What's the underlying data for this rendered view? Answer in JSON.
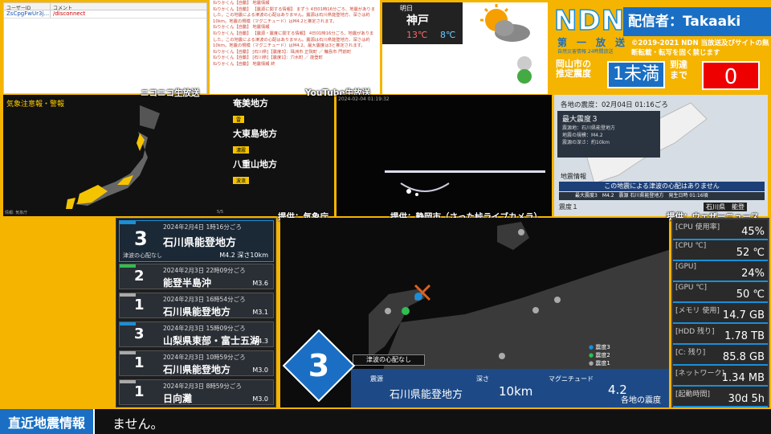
{
  "user_table": {
    "col_user": "ユーザーID",
    "col_comment": "コメント",
    "rows": [
      {
        "user": "ZsCpgFwUr3j...",
        "comment": "/disconnect"
      }
    ]
  },
  "log": [
    "ねりかくん【自動】 地震情報",
    "ねりかくん【自動】 【震源に関する情報】 まずう 4日01時16分ごろ、地震がありました。この地震による津波の心配はありません。震源は石川県能登地方、深さは約10km。地震の規模（マグニチュード）はM4.2と推定されます。",
    "ねりかくん【自動】 地震情報",
    "ねりかくん【自動】 【震源・震度に関する情報】 4日01時16分ごろ、地震がありました。この地震による津波の心配はありません。震源は石川県能登地方、深さは約10km。地震の規模（マグニチュード）はM4.2、最大震度は3と推定されます。",
    "ねりかくん【自動】 [石川県]【震度3】：珠洲市 正院町 ／ 輪島市 門前町",
    "ねりかくん【自動】 [石川県]【震度1】：穴水町 ／ 能登町",
    "ねりかくん【自動】 地震情報 終"
  ],
  "weather": {
    "day": "明日",
    "city": "神戸",
    "high": "13℃",
    "low": "8℃"
  },
  "ndn": {
    "logo": "NDN",
    "caster": "配信者：Takaaki",
    "first": "第　一　放　送",
    "first_sub": "自然災害情報 24時間放送",
    "copyright": "©2019-2021 NDN 当放送及びサイトの無断転載・転写を固く禁じます",
    "okayama": "岡山市の\n推定震度",
    "shindo": "1未満",
    "arrive": "到達\nまで",
    "seconds": "0"
  },
  "caps": {
    "nico": "ニコニコ生放送",
    "yt": "YouTube生放送",
    "jma": "提供：気象庁",
    "shizuoka": "提供：静岡市（さった峠ライブカメラ）",
    "wn": "提供：ウェザーニュース"
  },
  "japan": {
    "title": "気象注意報・警報",
    "areas": [
      {
        "name": "奄美地方",
        "badge": "雷"
      },
      {
        "name": "大東島地方",
        "badge": "濃霧"
      },
      {
        "name": "八重山地方",
        "badge": "波浪"
      }
    ],
    "page": "5/5",
    "footer": "情報: 気象庁"
  },
  "live": {
    "timestamp": "2024-02-04 01:19:32"
  },
  "info": {
    "header": "各地の震度：02月04日 01:16ごろ",
    "max": "最大震度３",
    "epi_label": "震源地：石川県能登地方",
    "mag_label": "地震の規模：M4.2",
    "depth_label": "震源の深さ：約10km",
    "tsunami": "この地震による津波の心配はありません",
    "badge": "地震情報",
    "bottom": "最大震度3　M4.2　震源 石川県能登地方　発生日時 01:16頃",
    "region": "石川県　能登",
    "level": "震度１"
  },
  "eq_list": [
    {
      "n": "3",
      "time": "2024年2月4日 1時16分ごろ",
      "place": "石川県能登地方",
      "mag": "M4.2 深さ10km",
      "note": "津波の心配なし",
      "color": "#1a8fd8"
    },
    {
      "n": "2",
      "time": "2024年2月3日 22時09分ごろ",
      "place": "能登半島沖",
      "mag": "M3.6",
      "color": "#2fbf4f"
    },
    {
      "n": "1",
      "time": "2024年2月3日 16時54分ごろ",
      "place": "石川県能登地方",
      "mag": "M3.1",
      "color": "#aaa"
    },
    {
      "n": "3",
      "time": "2024年2月3日 15時09分ごろ",
      "place": "山梨県東部・富士五湖",
      "mag": "M4.3",
      "color": "#1a8fd8"
    },
    {
      "n": "1",
      "time": "2024年2月3日 10時59分ごろ",
      "place": "石川県能登地方",
      "mag": "M3.0",
      "color": "#aaa"
    },
    {
      "n": "1",
      "time": "2024年2月3日 8時59分ごろ",
      "place": "日向灘",
      "mag": "M3.0",
      "color": "#aaa"
    }
  ],
  "main": {
    "shindo": "3",
    "tsunami": "津波の心配なし",
    "epi_label": "震源",
    "epi": "石川県能登地方",
    "depth_label": "深さ",
    "depth": "10km",
    "mag_label": "マグニチュード",
    "mag": "4.2",
    "legend": [
      "震度3",
      "震度2",
      "震度1"
    ],
    "each": "各地の震度"
  },
  "stats": [
    {
      "k": "[CPU 使用率]",
      "v": "45%"
    },
    {
      "k": "[CPU ℃]",
      "v": "52 ℃"
    },
    {
      "k": "[GPU]",
      "v": "24%"
    },
    {
      "k": "[GPU ℃]",
      "v": "50 ℃"
    },
    {
      "k": "[メモリ 使用]",
      "v": "14.7 GB"
    },
    {
      "k": "[HDD 残り]",
      "v": "1.78 TB"
    },
    {
      "k": "[C: 残り]",
      "v": "85.8 GB"
    },
    {
      "k": "[ネットワーク]",
      "v": "1.34 MB"
    },
    {
      "k": "[起動時間]",
      "v": "30d 5h"
    }
  ],
  "ticker": {
    "label": "直近地震情報",
    "text": "ません。"
  }
}
